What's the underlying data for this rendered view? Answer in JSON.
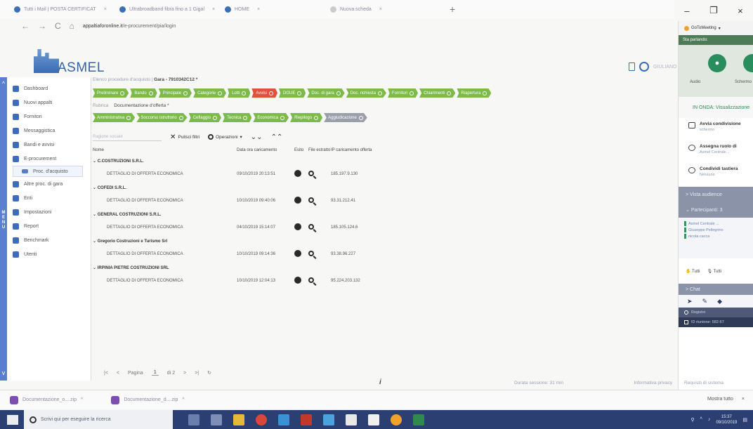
{
  "browser": {
    "tabs": [
      {
        "label": "Tutti i Mail | POSTA CERTIFICAT",
        "icon": "mail-icon"
      },
      {
        "label": "Ultrabroadband fibra fino a 1 Gigal",
        "icon": "globe-icon"
      },
      {
        "label": "HOME",
        "icon": "globe-icon"
      },
      {
        "label": "Nuova scheda",
        "icon": "blank-tab-icon"
      }
    ],
    "url": "appaltiaforonline.it",
    "url_rest": "/e-procurement/pia/login"
  },
  "logo": {
    "text": "ASMEL"
  },
  "header": {
    "username": "GIULIANO"
  },
  "sidebar": {
    "items": [
      {
        "label": "Dashboard",
        "icon": "home-icon"
      },
      {
        "label": "Nuovi appalti",
        "icon": "tender-icon"
      },
      {
        "label": "Fornitori",
        "icon": "suppliers-icon"
      },
      {
        "label": "Messaggistica",
        "icon": "message-icon"
      },
      {
        "label": "Bandi e avvisi",
        "icon": "megaphone-icon"
      },
      {
        "label": "E-procurement",
        "icon": "cart-icon"
      },
      {
        "label": "Proc. d'acquisto",
        "icon": "list-icon",
        "sub": true
      },
      {
        "label": "Altre proc. di gara",
        "icon": "folder-icon"
      },
      {
        "label": "Enti",
        "icon": "building-icon"
      },
      {
        "label": "Impostazioni",
        "icon": "gear-icon"
      },
      {
        "label": "Report",
        "icon": "chart-icon"
      },
      {
        "label": "Benchmark",
        "icon": "document-icon"
      },
      {
        "label": "Utenti",
        "icon": "users-icon"
      }
    ],
    "menu_letters": [
      "M",
      "E",
      "N",
      "U"
    ]
  },
  "main": {
    "breadcrumb_prefix": "Elenco procedure d'acquisto",
    "breadcrumb_current": "Gara - 7910342C12 *",
    "steps_row1": [
      {
        "label": "Preliminare",
        "state": "done"
      },
      {
        "label": "Bando",
        "state": "done"
      },
      {
        "label": "Principale",
        "state": "done"
      },
      {
        "label": "Categorie",
        "state": "done"
      },
      {
        "label": "Lotti",
        "state": "done"
      },
      {
        "label": "Avvisi",
        "state": "error"
      },
      {
        "label": "DGUE",
        "state": "done"
      },
      {
        "label": "Doc. di gara",
        "state": "done"
      },
      {
        "label": "Doc. richiesta",
        "state": "done"
      },
      {
        "label": "Fornitori",
        "state": "done"
      },
      {
        "label": "Chiarimenti",
        "state": "done"
      },
      {
        "label": "Riapertura",
        "state": "done"
      }
    ],
    "steps_row2": [
      {
        "label": "Amministrativa",
        "state": "done"
      },
      {
        "label": "Soccorso istruttorio",
        "state": "done"
      },
      {
        "label": "Ceflaggio",
        "state": "done"
      },
      {
        "label": "Tecnica",
        "state": "done"
      },
      {
        "label": "Economica",
        "state": "done"
      },
      {
        "label": "Riepilogo",
        "state": "done"
      },
      {
        "label": "Aggiudicazione",
        "state": "pending"
      }
    ],
    "subtabs": [
      "Rubrica",
      "Documentazione d'offerta *"
    ],
    "toolbar": {
      "search_placeholder": "Ragione sociale",
      "clear_filters": "Pulisci filtri",
      "operations": "Operazioni"
    },
    "table": {
      "headers": [
        "Nome",
        "Data ora caricamento",
        "Esito",
        "File estratto",
        "IP caricamento offerta"
      ],
      "groups": [
        {
          "name": "C.COSTRUZIONI S.R.L.",
          "detail": "DETTAGLIO DI OFFERTA ECONOMICA",
          "datetime": "09/10/2019 20:13:51",
          "ip": "185.197.9.130"
        },
        {
          "name": "COFEDI S.R.L.",
          "detail": "DETTAGLIO DI OFFERTA ECONOMICA",
          "datetime": "10/10/2019 09:40:06",
          "ip": "93.31.212.41"
        },
        {
          "name": "GENERAL COSTRUZIONI S.R.L.",
          "detail": "DETTAGLIO DI OFFERTA ECONOMICA",
          "datetime": "04/10/2019 15:14:07",
          "ip": "185.105.124.6"
        },
        {
          "name": "Gregorio Costruzioni e Turismo Srl",
          "detail": "DETTAGLIO DI OFFERTA ECONOMICA",
          "datetime": "10/10/2019 09:14:36",
          "ip": "93.38.96.227"
        },
        {
          "name": "IRPINIA PIETRE COSTRUZIONI SRL",
          "detail": "DETTAGLIO DI OFFERTA ECONOMICA",
          "datetime": "10/10/2019 12:04:13",
          "ip": "95.224.203.132"
        }
      ]
    },
    "pager": {
      "label": "Pagina",
      "current": "1",
      "total": "di 2"
    },
    "footer": {
      "session": "Durata sessione: 31 min",
      "privacy": "Informativa privacy"
    }
  },
  "panel": {
    "app": "GoToMeeting",
    "talking": "Sta parlando:",
    "audio_label": "Audio",
    "screen_label": "Schermo",
    "status": "IN ONDA: Visualizzazione",
    "items": [
      {
        "title": "Avvia condivisione",
        "sub": "schermo",
        "icon": "screen-share-icon"
      },
      {
        "title": "Assegna ruolo di",
        "sub": "Asmel Centrale...",
        "icon": "user-role-icon"
      },
      {
        "title": "Condividi tastiera",
        "sub": "Nessuno",
        "icon": "keyboard-icon"
      }
    ],
    "audience": "Vista audience",
    "participants_label": "Partecipanti: 3",
    "participants": [
      "Asmel Centrale ...",
      "Giuseppe Pellegrino",
      "nicola cacca"
    ],
    "filter_all_1": "Tutti",
    "filter_all_2": "Tutti",
    "chat": "Chat",
    "registration": "Registro",
    "meeting_id": "ID riunione: 582-67",
    "requirements": "Requisiti di sistema"
  },
  "downloads": {
    "files": [
      "Documentazione_o....zip",
      "Documentazione_d....zip"
    ],
    "show_all": "Mostra tutto"
  },
  "taskbar": {
    "search": "Scrivi qui per eseguire la ricerca",
    "time": "15:37",
    "date": "09/10/2019"
  },
  "colors": {
    "accent": "#3d6dba",
    "step_done": "#7cba4a",
    "step_error": "#e0523c",
    "step_pending": "#9aa0aa",
    "taskbar": "#2c3f73",
    "live_green": "#2f8a4f"
  }
}
